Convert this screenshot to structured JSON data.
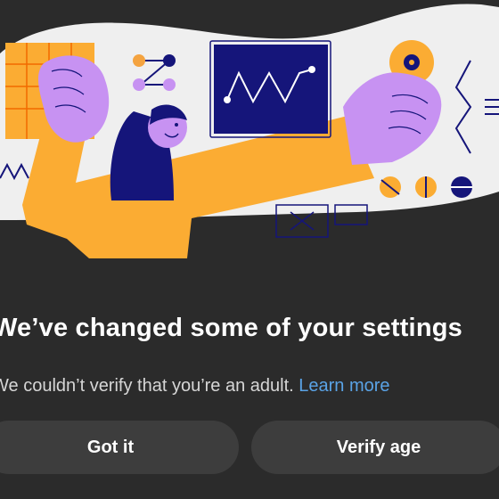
{
  "dialog": {
    "title": "We’ve changed some of your settings",
    "message": "We couldn’t verify that you’re an adult.",
    "link_label": "Learn more",
    "buttons": {
      "got_it": "Got it",
      "verify_age": "Verify age"
    }
  },
  "colors": {
    "background": "#2b2b2b",
    "illustration_bg": "#efefef",
    "orange": "#fbac33",
    "purple": "#c792f2",
    "navy": "#15157a",
    "link": "#5aa3e6",
    "button": "#3d3d3d"
  }
}
